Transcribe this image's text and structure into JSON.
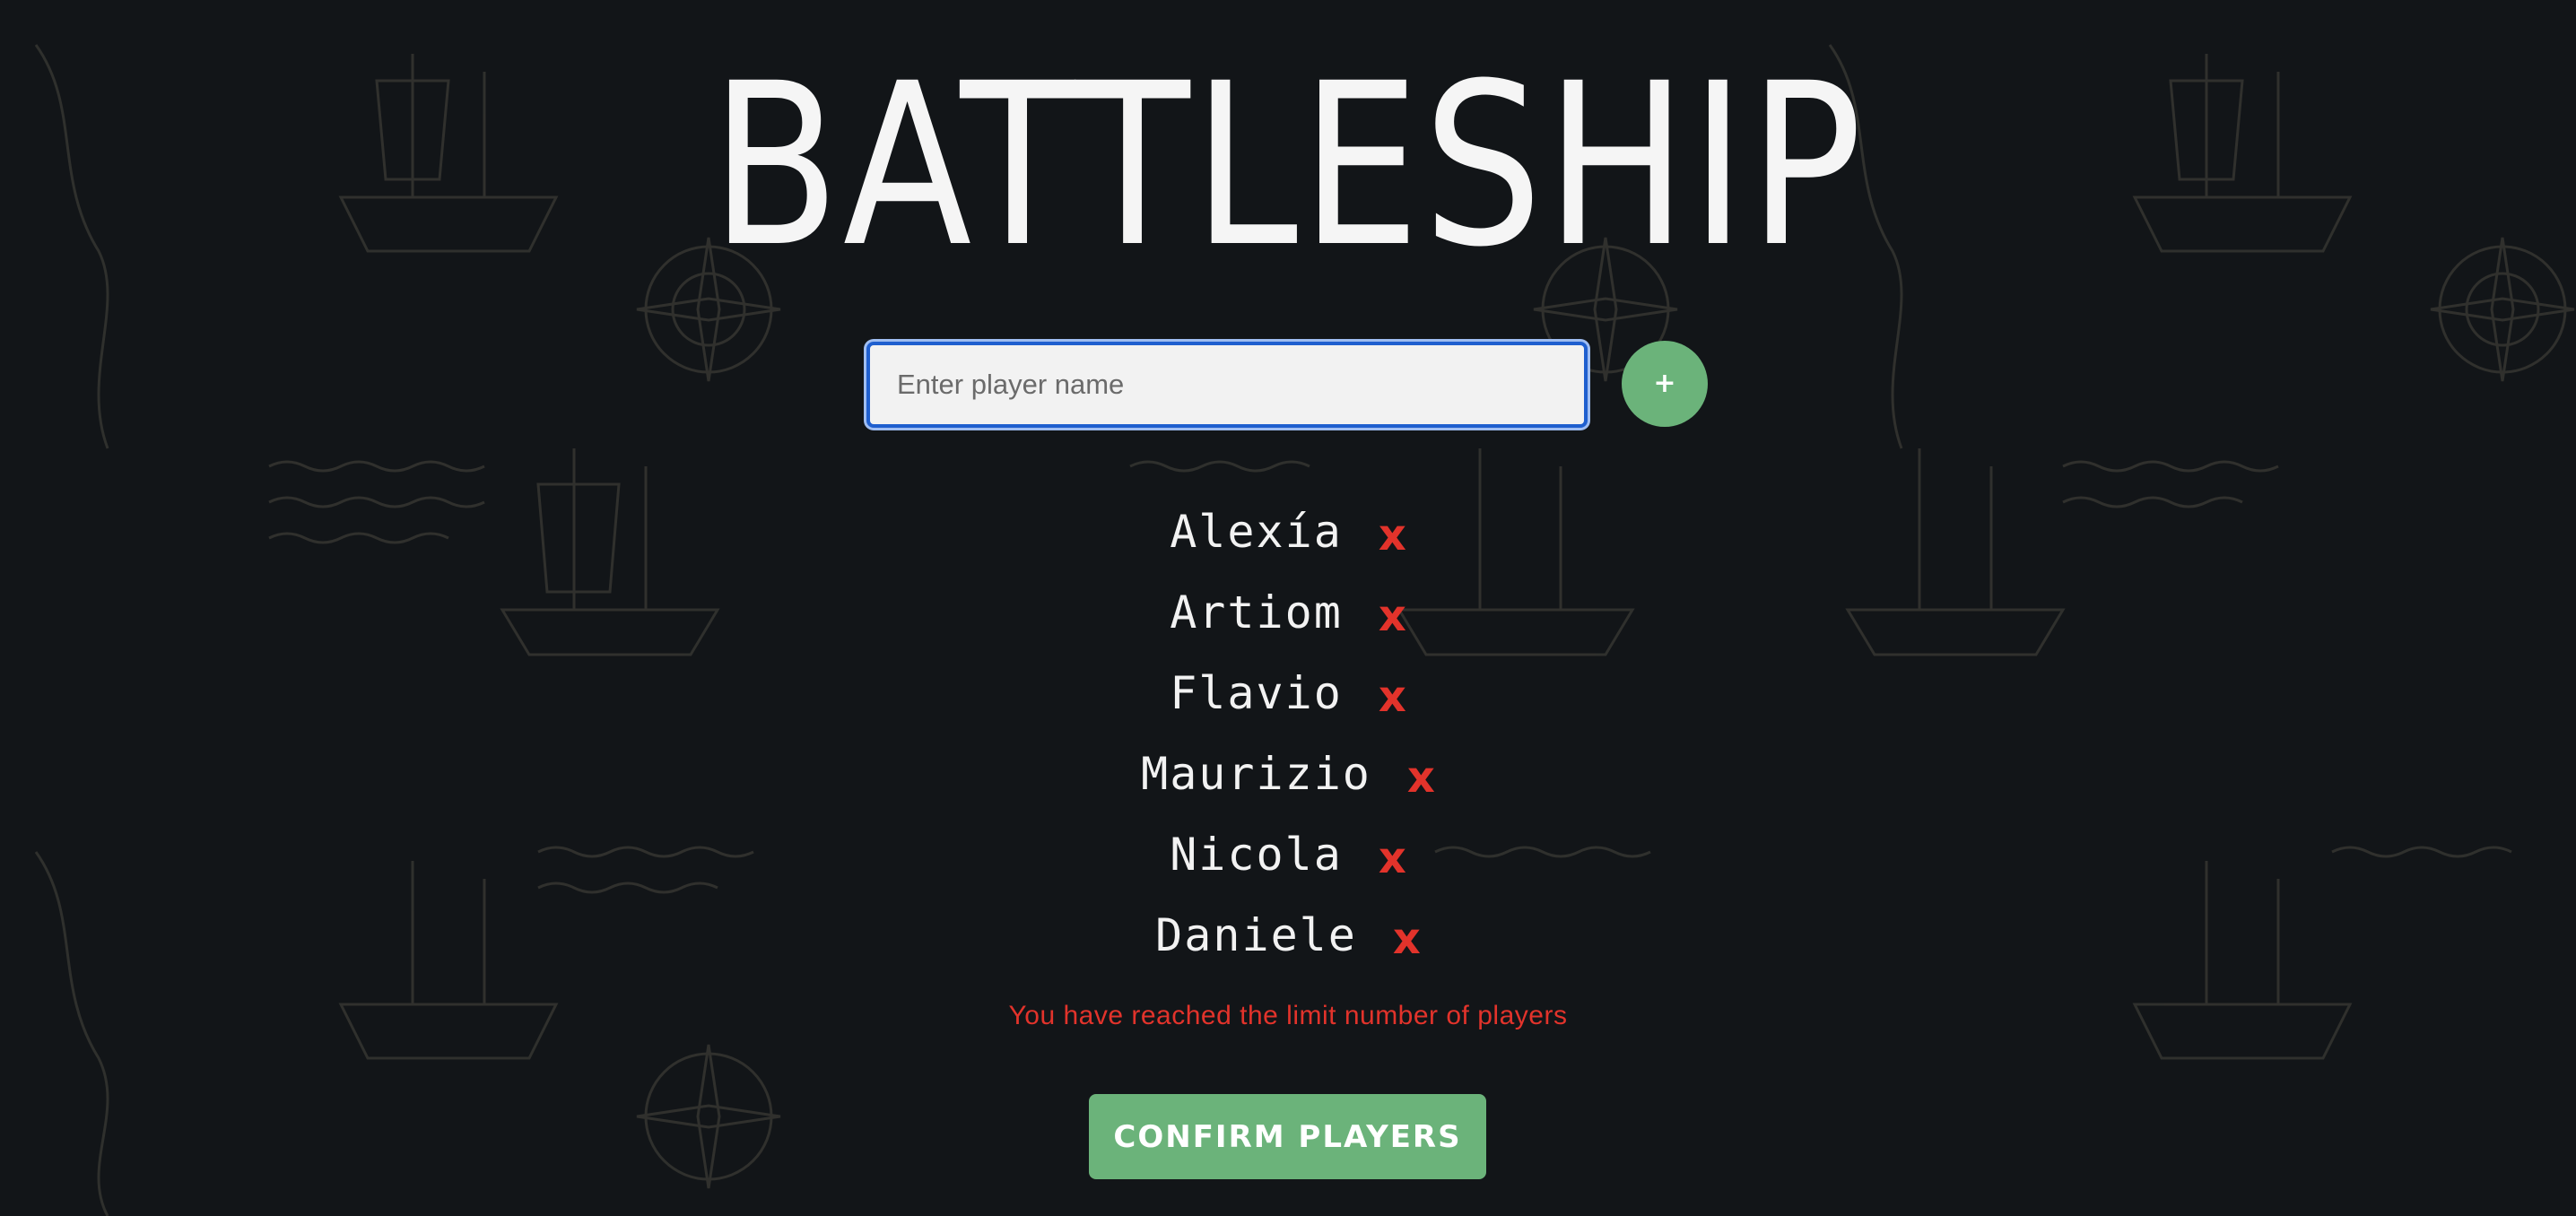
{
  "app": {
    "title": "BATTLESHIP"
  },
  "form": {
    "input_placeholder": "Enter player name",
    "input_value": "",
    "add_label": "+"
  },
  "players": [
    {
      "name": "Alexía",
      "remove_label": "x"
    },
    {
      "name": "Artiom",
      "remove_label": "x"
    },
    {
      "name": "Flavio",
      "remove_label": "x"
    },
    {
      "name": "Maurizio",
      "remove_label": "x"
    },
    {
      "name": "Nicola",
      "remove_label": "x"
    },
    {
      "name": "Daniele",
      "remove_label": "x"
    }
  ],
  "messages": {
    "limit": "You have reached the limit number of players"
  },
  "actions": {
    "confirm_label": "CONFIRM PLAYERS"
  },
  "colors": {
    "background": "#121518",
    "accent_green": "#6bb37a",
    "error_red": "#e2332b",
    "input_focus_border": "#1f5fcf"
  }
}
